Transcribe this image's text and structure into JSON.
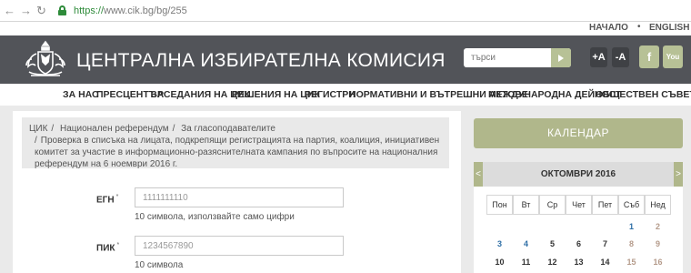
{
  "browser": {
    "url_scheme": "https://",
    "url_rest": "www.cik.bg/bg/255",
    "back_icon": "back-icon",
    "forward_icon": "forward-icon",
    "reload_icon": "reload-icon"
  },
  "utility": {
    "home": "НАЧАЛО",
    "sep": "•",
    "english": "ENGLISH"
  },
  "header": {
    "title": "ЦЕНТРАЛНА ИЗБИРАТЕЛНА КОМИСИЯ",
    "search_placeholder": "търси",
    "font_larger": "+A",
    "font_smaller": "-A",
    "facebook": "f",
    "youtube": "You"
  },
  "nav": {
    "items": [
      "ЗА НАС",
      "ПРЕСЦЕНТЪР",
      "ЗАСЕДАНИЯ НА ЦИК",
      "РЕШЕНИЯ НА ЦИК",
      "РЕГИСТРИ",
      "НОРМАТИВНИ И ВЪТРЕШНИ АКТОВЕ",
      "МЕЖДУНАРОДНА ДЕЙНОСТ",
      "ОБЩЕСТВЕН СЪВЕТ"
    ]
  },
  "breadcrumb": {
    "items": [
      "ЦИК",
      "Национален референдум",
      "За гласоподавателите"
    ],
    "separator": "/",
    "current": "Проверка в списъка на лицата, подкрепящи регистрацията на партия, коалиция, инициативен комитет за участие в информационно-разяснителната кампания по въпросите на националния референдум на 6 ноември 2016 г."
  },
  "form": {
    "egn_label": "ЕГН",
    "egn_placeholder": "1111111110",
    "egn_hint": "10 символа, използвайте само цифри",
    "pik_label": "ПИК",
    "pik_placeholder": "1234567890",
    "pik_hint": "10 символа",
    "required_mark": "*"
  },
  "sidebar": {
    "calendar_button": "КАЛЕНДАР",
    "month": "ОКТОМВРИ 2016",
    "prev": "<",
    "next": ">",
    "weekdays": [
      "Пон",
      "Вт",
      "Ср",
      "Чет",
      "Пет",
      "Съб",
      "Нед"
    ],
    "weeks": [
      [
        "",
        "",
        "",
        "",
        "",
        "1",
        "2"
      ],
      [
        "3",
        "4",
        "5",
        "6",
        "7",
        "8",
        "9"
      ],
      [
        "10",
        "11",
        "12",
        "13",
        "14",
        "15",
        "16"
      ]
    ]
  },
  "colors": {
    "header_bg": "#525459",
    "accent": "#b0b78b",
    "link_blue": "#2f6fa6"
  }
}
